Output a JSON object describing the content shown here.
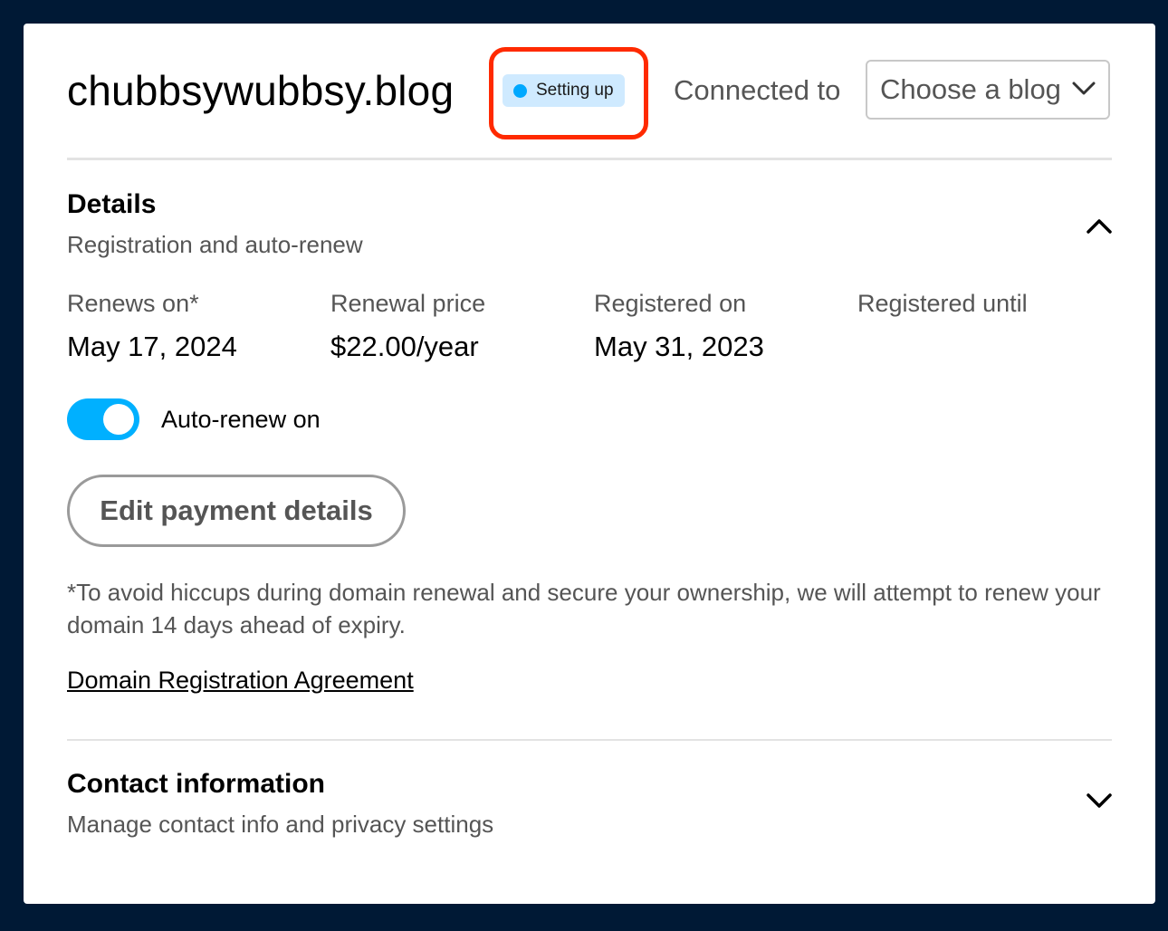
{
  "header": {
    "domain": "chubbsywubbsy.blog",
    "status_badge": "Setting up",
    "connected_label": "Connected to",
    "blog_select_value": "Choose a blog"
  },
  "details": {
    "title": "Details",
    "subtitle": "Registration and auto-renew",
    "fields": [
      {
        "label": "Renews on*",
        "value": "May 17, 2024"
      },
      {
        "label": "Renewal price",
        "value": "$22.00/year"
      },
      {
        "label": "Registered on",
        "value": "May 31, 2023"
      },
      {
        "label": "Registered until",
        "value": ""
      }
    ],
    "auto_renew_label": "Auto-renew on",
    "auto_renew_on": true,
    "edit_button": "Edit payment details",
    "footnote": "*To avoid hiccups during domain renewal and secure your ownership, we will attempt to renew your domain 14 days ahead of expiry.",
    "agreement_link": "Domain Registration Agreement"
  },
  "contact": {
    "title": "Contact information",
    "subtitle": "Manage contact info and privacy settings"
  },
  "colors": {
    "page_bg": "#001935",
    "toggle_on": "#00b0ff",
    "status_dot": "#00a8ff",
    "status_badge_bg": "#cfeaff",
    "highlight": "#ff2a00"
  }
}
